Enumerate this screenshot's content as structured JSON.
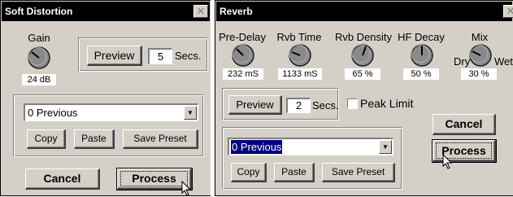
{
  "soft_distortion": {
    "title": "Soft Distortion",
    "close_glyph": "✕",
    "gain": {
      "label": "Gain",
      "value": "24 dB"
    },
    "preview_label": "Preview",
    "preview_secs_value": "5",
    "secs_label": "Secs.",
    "preset_value": "0 Previous",
    "copy_label": "Copy",
    "paste_label": "Paste",
    "save_preset_label": "Save Preset",
    "cancel_label": "Cancel",
    "process_label": "Process"
  },
  "reverb": {
    "title": "Reverb",
    "close_glyph": "✕",
    "knobs": [
      {
        "label": "Pre-Delay",
        "value": "232 mS"
      },
      {
        "label": "Rvb Time",
        "value": "1133 mS"
      },
      {
        "label": "Rvb Density",
        "value": "65 %"
      },
      {
        "label": "HF Decay",
        "value": "50 %"
      },
      {
        "label": "Mix",
        "value": "30 %",
        "left_label": "Dry",
        "right_label": "Wet"
      }
    ],
    "preview_label": "Preview",
    "preview_secs_value": "2",
    "secs_label": "Secs.",
    "peak_limit_label": "Peak Limit",
    "peak_limit_checked": false,
    "preset_value": "0 Previous",
    "copy_label": "Copy",
    "paste_label": "Paste",
    "save_preset_label": "Save Preset",
    "cancel_label": "Cancel",
    "process_label": "Process"
  },
  "colors": {
    "dialog_bg": "#d4d0c8",
    "titlebar_bg": "#000000",
    "selection_bg": "#000080"
  },
  "icons": [
    "close-icon",
    "knob-icon",
    "dropdown-arrow-icon",
    "mouse-pointer-icon"
  ]
}
